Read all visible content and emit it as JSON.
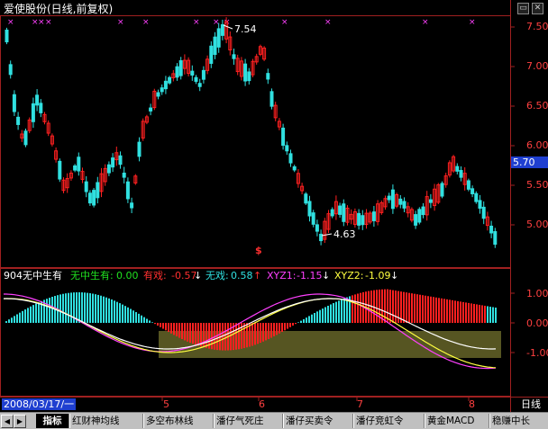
{
  "window": {
    "title": "爱使股份(日线,前复权)",
    "buttons": [
      "minimize",
      "close"
    ]
  },
  "main_chart": {
    "price_axis_labels": [
      "7.50",
      "7.00",
      "6.50",
      "6.00",
      "5.50",
      "5.00"
    ],
    "current_price": "5.70",
    "high_marker": "7.54",
    "low_marker": "4.63",
    "colors": {
      "up": "#ff2020",
      "down": "#30e0e0",
      "marker": "#ff40ff"
    }
  },
  "indicator": {
    "name": "904无中生有",
    "wzsy_label": "无中生有:",
    "wzsy_value": "0.00",
    "youxi_label": "有戏:",
    "youxi_value": "-0.57",
    "wuxi_label": "无戏:",
    "wuxi_value": "0.58",
    "xyz1_label": "XYZ1:",
    "xyz1_value": "-1.15",
    "xyz2_label": "XYZ2:",
    "xyz2_value": "-1.09",
    "axis_labels": [
      "1.00",
      "0.00",
      "-1.00"
    ]
  },
  "date_axis": {
    "start_date": "2008/03/17/一",
    "months": [
      "5",
      "6",
      "7",
      "8"
    ],
    "period": "日线"
  },
  "tabs": [
    "指标",
    "红财神均线",
    "多空布林线",
    "潘仔气死庄",
    "潘仔买卖令",
    "潘仔竞虹令",
    "黄金MACD",
    "稳赚中长"
  ],
  "active_tab": "指标"
}
